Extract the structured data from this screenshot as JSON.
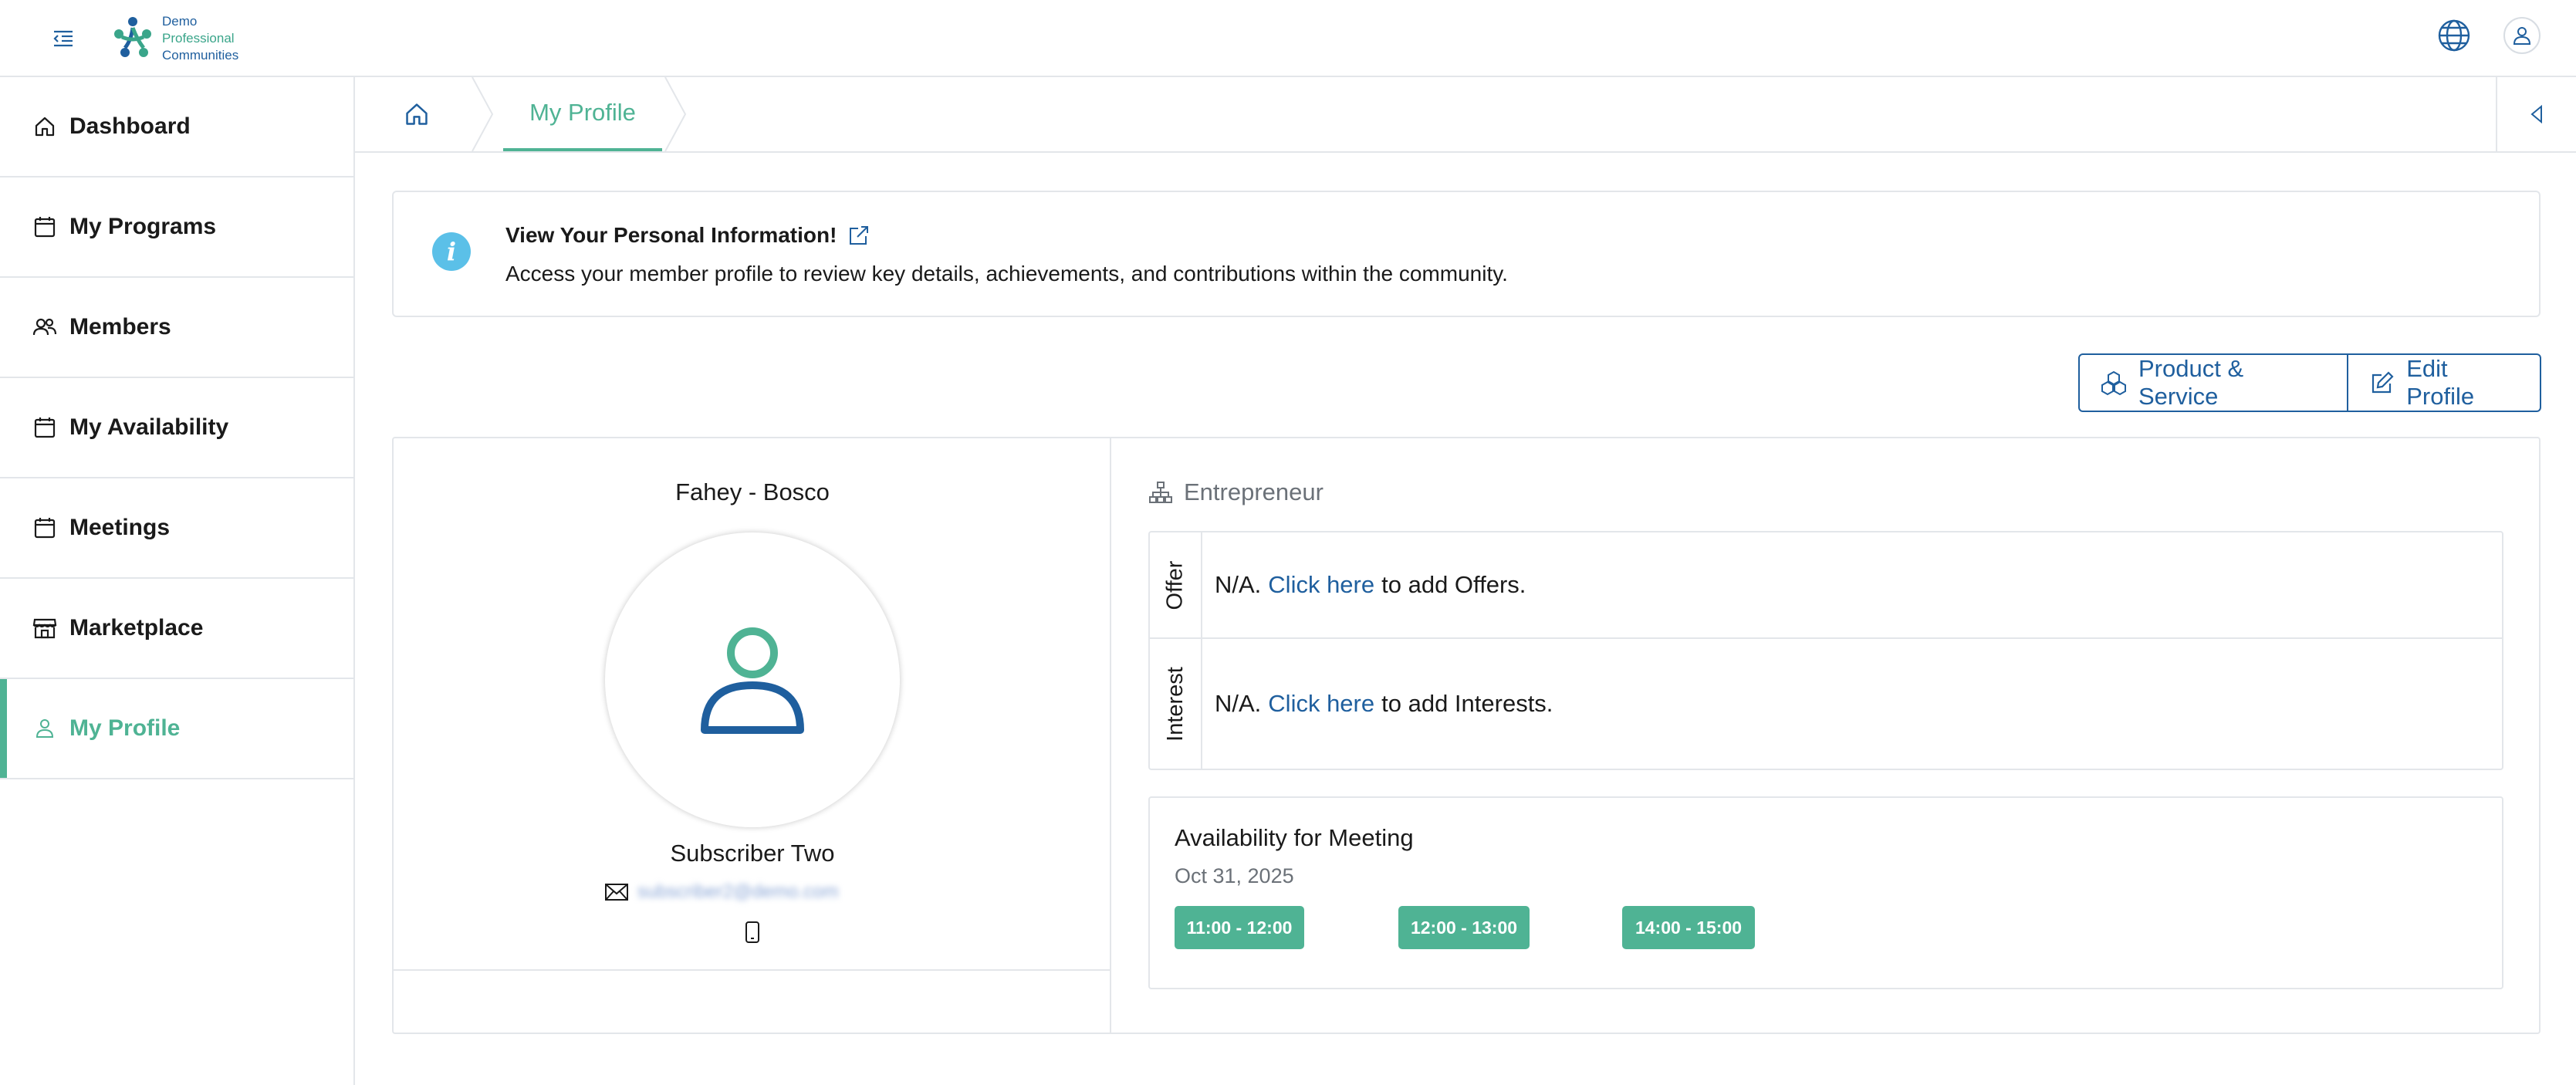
{
  "header": {
    "logo": {
      "line1": "Demo",
      "line2": "Professional",
      "line3": "Communities"
    },
    "icons": {
      "menu": "menu-toggle-icon",
      "language": "globe-icon",
      "account": "user-icon"
    }
  },
  "sidebar": {
    "items": [
      {
        "label": "Dashboard",
        "icon": "home-icon",
        "active": false
      },
      {
        "label": "My Programs",
        "icon": "calendar-icon",
        "active": false
      },
      {
        "label": "Members",
        "icon": "users-icon",
        "active": false
      },
      {
        "label": "My Availability",
        "icon": "calendar-icon",
        "active": false
      },
      {
        "label": "Meetings",
        "icon": "calendar-icon",
        "active": false
      },
      {
        "label": "Marketplace",
        "icon": "store-icon",
        "active": false
      },
      {
        "label": "My Profile",
        "icon": "user-icon",
        "active": true
      }
    ],
    "accent": "#4fb394"
  },
  "breadcrumb": {
    "current": "My Profile"
  },
  "info": {
    "title": "View Your Personal Information!",
    "description": "Access your member profile to review key details, achievements, and contributions within the community."
  },
  "actions": {
    "product_service": "Product & Service",
    "edit_profile": "Edit Profile"
  },
  "profile": {
    "company": "Fahey - Bosco",
    "name": "Subscriber Two",
    "email": "subscriber2@demo.com",
    "role": "Entrepreneur"
  },
  "offers": {
    "label": "Offer",
    "prefix": "N/A.",
    "link": "Click here",
    "suffix": "to add Offers."
  },
  "interests": {
    "label": "Interest",
    "prefix": "N/A.",
    "link": "Click here",
    "suffix": "to add Interests."
  },
  "availability": {
    "title": "Availability for Meeting",
    "date": "Oct 31, 2025",
    "slots": [
      "11:00 - 12:00",
      "12:00 - 13:00",
      "14:00 - 15:00"
    ]
  },
  "colors": {
    "primary": "#1f5f9e",
    "accent": "#4fb394",
    "info": "#5bc0e8"
  }
}
